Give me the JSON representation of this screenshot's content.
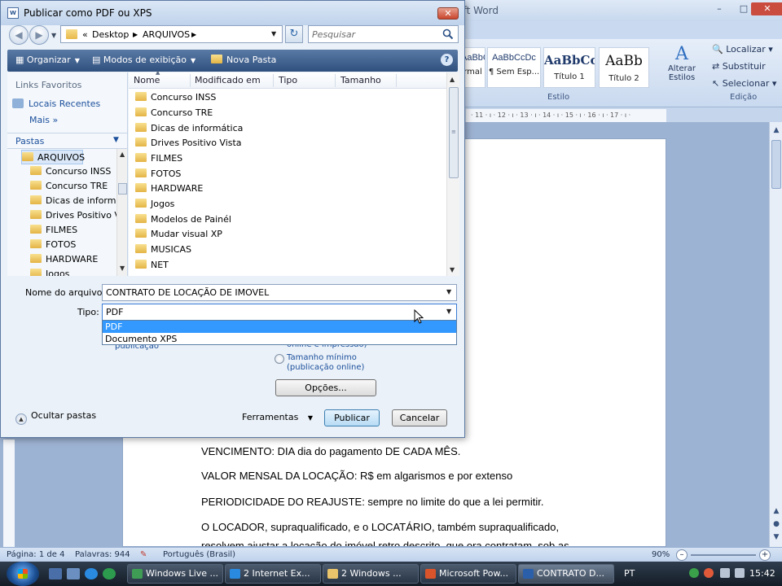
{
  "dialog": {
    "title": "Publicar como PDF ou XPS",
    "close_label": "✕",
    "address": {
      "prefix": "«",
      "segments": [
        "Desktop",
        "ARQUIVOS"
      ]
    },
    "search_placeholder": "Pesquisar",
    "toolbar": {
      "organize": "Organizar",
      "views": "Modos de exibição",
      "new_folder": "Nova Pasta",
      "help": "?"
    },
    "nav": {
      "favorites_heading": "Links Favoritos",
      "recent_places": "Locais Recentes",
      "more": "Mais",
      "more_chevron": "»",
      "folders_label": "Pastas",
      "tree": [
        "ARQUIVOS",
        "Concurso INSS",
        "Concurso TRE",
        "Dicas de informá",
        "Drives Positivo V",
        "FILMES",
        "FOTOS",
        "HARDWARE",
        "Jogos"
      ]
    },
    "columns": [
      "Nome",
      "Modificado em",
      "Tipo",
      "Tamanho"
    ],
    "files": [
      "Concurso INSS",
      "Concurso TRE",
      "Dicas de informática",
      "Drives Positivo Vista",
      "FILMES",
      "FOTOS",
      "HARDWARE",
      "Jogos",
      "Modelos de Painél",
      "Mudar visual XP",
      "MUSICAS",
      "NET"
    ],
    "filename_label": "Nome do arquivo:",
    "filename_value": "CONTRATO DE LOCAÇÃO DE IMOVEL",
    "type_label": "Tipo:",
    "type_value": "PDF",
    "type_options": [
      "PDF",
      "Documento XPS"
    ],
    "behind_dropdown": {
      "left_fragment": "publicação",
      "right_fragment": "online e impressão)",
      "min_size_line1": "Tamanho mínimo",
      "min_size_line2": "(publicação online)"
    },
    "options_button": "Opções...",
    "hide_folders": "Ocultar pastas",
    "tools": "Ferramentas",
    "publish": "Publicar",
    "cancel": "Cancelar"
  },
  "word": {
    "title_fragment": "soft Word",
    "styles": [
      {
        "sample": "AaBbCcDc",
        "name": "rmal"
      },
      {
        "sample": "AaBbCcDc",
        "name": "¶ Sem Esp..."
      },
      {
        "sample": "AaBbCc",
        "name": "Título 1"
      },
      {
        "sample": "AaBb",
        "name": "Título 2"
      }
    ],
    "change_styles_line1": "Alterar",
    "change_styles_line2": "Estilos",
    "style_group_label": "Estilo",
    "edit_group_label": "Edição",
    "edit": {
      "find": "Localizar",
      "replace": "Substituir",
      "select": "Selecionar"
    },
    "ruler_text": "· 11 · ı · 12 · ı · 13 · ı · 14 · ı · 15 · ı · 16 · ı · 17 · ı ·",
    "doc": {
      "line1": "VENCIMENTO: DIA dia do pagamento DE CADA MÊS.",
      "line2": "VALOR MENSAL DA LOCAÇÃO:  R$ em algarismos  e por extenso",
      "line3": "PERIODICIDADE DO REAJUSTE:  sempre no limite  do que a lei permitir.",
      "line4": "O   LOCADOR,   supraqualificado,   e   o   LOCATÁRIO,   também   supraqualificado,",
      "line5": "resolvem  ajustar  a  locação  do  imóvel  retro  descrito,  que  ora  contratam,  sob  as"
    },
    "status": {
      "page": "Página: 1 de 4",
      "words": "Palavras: 944",
      "language": "Português (Brasil)",
      "zoom": "90%"
    }
  },
  "taskbar": {
    "tasks": [
      "Windows Live ...",
      "2 Internet Ex...",
      "2 Windows ...",
      "Microsoft Pow...",
      "CONTRATO D..."
    ],
    "language": "PT",
    "time": "15:42"
  },
  "colors": {
    "accent": "#3399ff",
    "dialog_toolbar": "#2f4f7d",
    "link": "#1c4f9c"
  }
}
